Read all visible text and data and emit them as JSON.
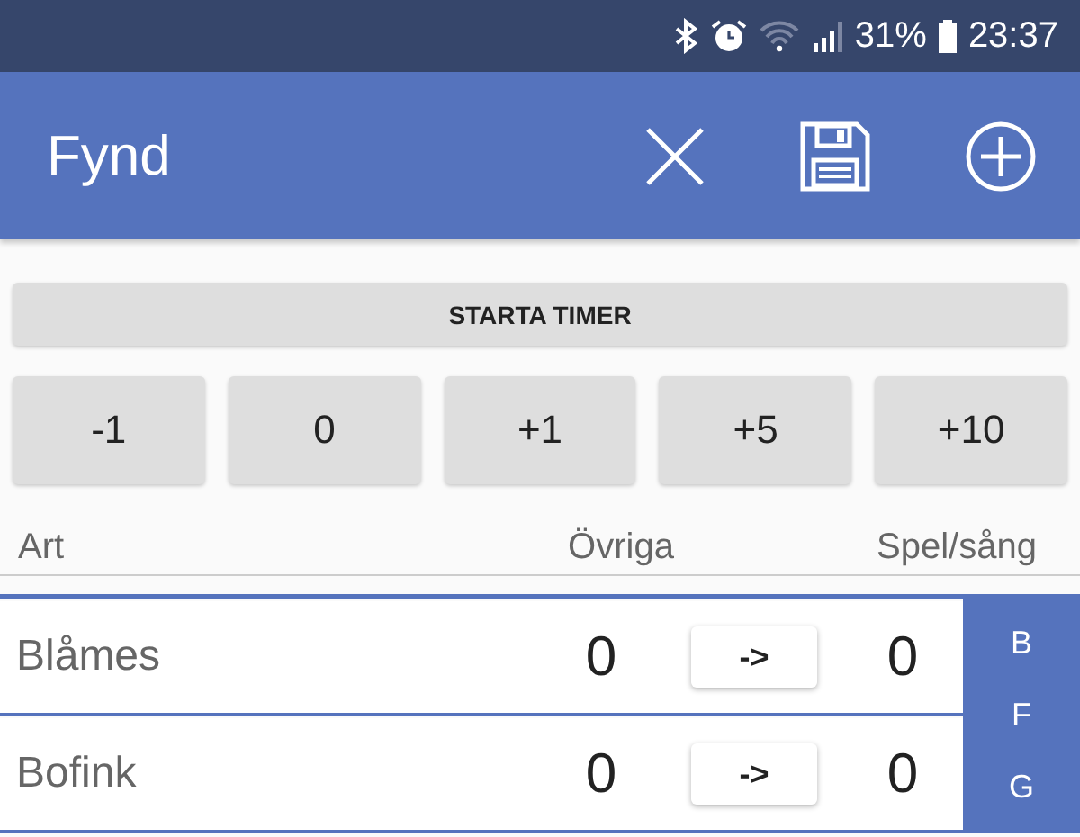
{
  "status_bar": {
    "battery": "31%",
    "time": "23:37"
  },
  "app_bar": {
    "title": "Fynd"
  },
  "timer_button": "STARTA TIMER",
  "step_buttons": [
    "-1",
    "0",
    "+1",
    "+5",
    "+10"
  ],
  "columns": [
    "Art",
    "Övriga",
    "Spel/sång"
  ],
  "rows": [
    {
      "name": "Blåmes",
      "ovriga": "0",
      "move": "->",
      "spel": "0"
    },
    {
      "name": "Bofink",
      "ovriga": "0",
      "move": "->",
      "spel": "0"
    }
  ],
  "index": [
    "B",
    "F",
    "G"
  ]
}
